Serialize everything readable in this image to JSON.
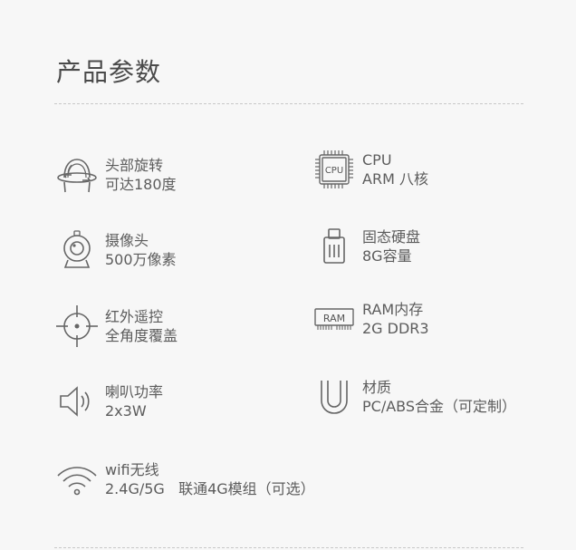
{
  "title": "产品参数",
  "specs": [
    {
      "name": "头部旋转",
      "value": "可达180度",
      "icon": "rotating-head-icon"
    },
    {
      "name": "CPU",
      "value": "ARM 八核",
      "icon": "cpu-chip-icon",
      "icon_text": "CPU"
    },
    {
      "name": "摄像头",
      "value": "500万像素",
      "icon": "webcam-icon"
    },
    {
      "name": "固态硬盘",
      "value": "8G容量",
      "icon": "usb-storage-icon"
    },
    {
      "name": "红外遥控",
      "value": "全角度覆盖",
      "icon": "infrared-target-icon"
    },
    {
      "name": "RAM内存",
      "value": "2G DDR3",
      "icon": "ram-module-icon",
      "icon_text": "RAM"
    },
    {
      "name": "喇叭功率",
      "value": "2x3W",
      "icon": "speaker-icon"
    },
    {
      "name": "材质",
      "value": "PC/ABS合金（可定制）",
      "icon": "magnet-u-icon"
    },
    {
      "name": "wifi无线",
      "value": "2.4G/5G   联通4G模组（可选）",
      "icon": "wifi-icon"
    }
  ]
}
